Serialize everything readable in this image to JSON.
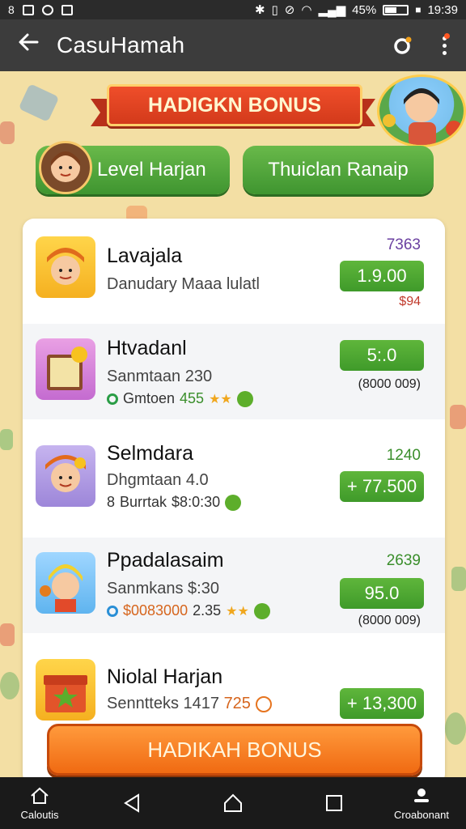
{
  "status_bar": {
    "battery": "45%",
    "time": "19:39"
  },
  "app_bar": {
    "title": "CasuHamah"
  },
  "banner": {
    "title": "HADIGKN BONUS"
  },
  "tabs": [
    {
      "label": "Level Harjan"
    },
    {
      "label": "Thuiclan Ranaip"
    }
  ],
  "rows": [
    {
      "title": "Lavajala",
      "subtitle": "Danudary Maaa lulatl",
      "top_value": "7363",
      "price": "1.9.00",
      "bottom_value": "$94"
    },
    {
      "title": "Htvadanl",
      "subtitle": "Sanmtaan 230",
      "detail_label": "Gmtoen",
      "detail_value": "455",
      "top_value": "",
      "price": "5:.0",
      "bottom_value": "(8000 009)"
    },
    {
      "title": "Selmdara",
      "subtitle": "Dhgmtaan 4.0",
      "detail_label": "Burrtak",
      "detail_value": "$8:0:30",
      "detail_prefix": "8",
      "top_value": "1240",
      "price": "+ 77.500",
      "bottom_value": ""
    },
    {
      "title": "Ppadalasaim",
      "subtitle": "Sanmkans $:30",
      "detail_label": "$0083000",
      "detail_value": "2.35",
      "top_value": "2639",
      "price": "95.0",
      "bottom_value": "(8000 009)"
    },
    {
      "title": "Niolal Harjan",
      "subtitle": "Senntteks 1417",
      "subtitle_extra": "725",
      "top_value": "",
      "price": "+ 13,300",
      "bottom_value": ""
    }
  ],
  "cta": {
    "label": "HADIKAH BONUS"
  },
  "nav_bar": {
    "left_label": "Caloutis",
    "right_label": "Croabonant"
  },
  "colors": {
    "accent_green": "#4caf37",
    "banner_red": "#e54525",
    "cta_orange": "#f57c1f",
    "background": "#f3dfa4"
  }
}
